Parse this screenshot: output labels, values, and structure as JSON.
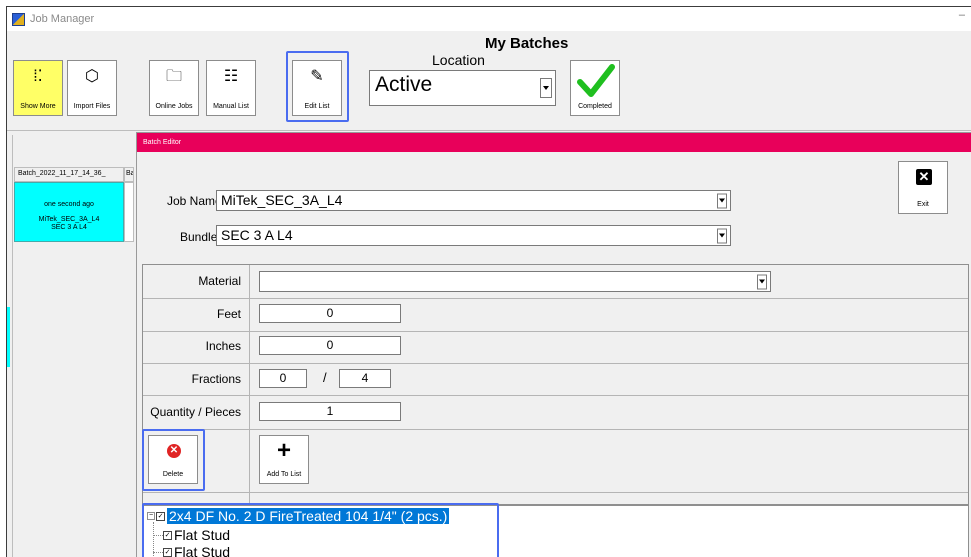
{
  "window": {
    "title": "Job Manager",
    "minimize_glyph": "–"
  },
  "toolbar": {
    "show_more": "Show More",
    "import_files": "Import Files",
    "online_jobs": "Online Jobs",
    "manual_list": "Manual List",
    "edit_list": "Edit List",
    "completed": "Completed"
  },
  "header": {
    "title": "My Batches",
    "location_label": "Location",
    "location_value": "Active"
  },
  "batches": {
    "tab1": "Batch_2022_11_17_14_36_",
    "tab2": "Ba",
    "card_time": "one second ago",
    "card_job": "MiTek_SEC_3A_L4",
    "card_bundle": "SEC 3 A L4"
  },
  "editor": {
    "title": "Batch Editor",
    "job_name_label": "Job Name",
    "job_name_value": "MiTek_SEC_3A_L4",
    "bundle_label": "Bundle",
    "bundle_value": "SEC 3 A L4",
    "exit_label": "Exit",
    "material_label": "Material",
    "material_value": "",
    "feet_label": "Feet",
    "feet_value": "0",
    "inches_label": "Inches",
    "inches_value": "0",
    "fractions_label": "Fractions",
    "fraction_numerator": "0",
    "fraction_separator": "/",
    "fraction_denominator": "4",
    "quantity_label": "Quantity / Pieces",
    "quantity_value": "1",
    "delete_label": "Delete",
    "add_label": "Add To List"
  },
  "tree": {
    "root": "2x4 DF No. 2 D FireTreated 104 1/4\" (2 pcs.)",
    "child1": "Flat Stud",
    "child2": "Flat Stud"
  },
  "colors": {
    "editor_title_bar": "#e8005a",
    "batch_card": "#00ffff",
    "show_more_bg": "#ffff66",
    "highlight": "#4a6cf0",
    "selection": "#0078d7"
  }
}
